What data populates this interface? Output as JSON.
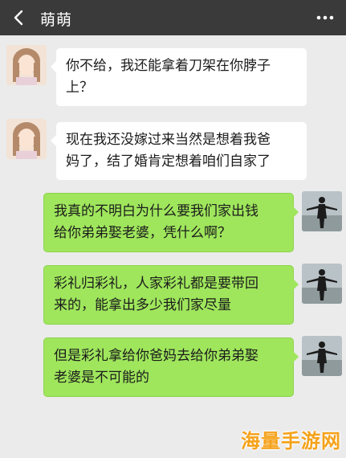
{
  "header": {
    "title": "萌萌",
    "back_icon": "chevron-left-icon",
    "more_icon": "more-dots-icon"
  },
  "colors": {
    "header_bg": "#3a3a3a",
    "chat_bg": "#ebebeb",
    "incoming_bubble": "#ffffff",
    "outgoing_bubble": "#9fe65c",
    "watermark": "#f5a21a"
  },
  "messages": [
    {
      "side": "incoming",
      "lines": [
        "你不给，我还能拿着刀架在你脖子",
        "上？"
      ]
    },
    {
      "side": "incoming",
      "lines": [
        "现在我还没嫁过来当然是想着我爸",
        "妈了，结了婚肯定想着咱们自家了"
      ]
    },
    {
      "side": "outgoing",
      "lines": [
        "我真的不明白为什么要我们家出钱",
        "给你弟弟娶老婆，凭什么啊？"
      ]
    },
    {
      "side": "outgoing",
      "lines": [
        "彩礼归彩礼，人家彩礼都是要带回",
        "来的，能拿出多少我们家尽量"
      ]
    },
    {
      "side": "outgoing",
      "lines": [
        "但是彩礼拿给你爸妈去给你弟弟娶",
        "老婆是不可能的"
      ]
    }
  ],
  "watermark": "海量手游网"
}
